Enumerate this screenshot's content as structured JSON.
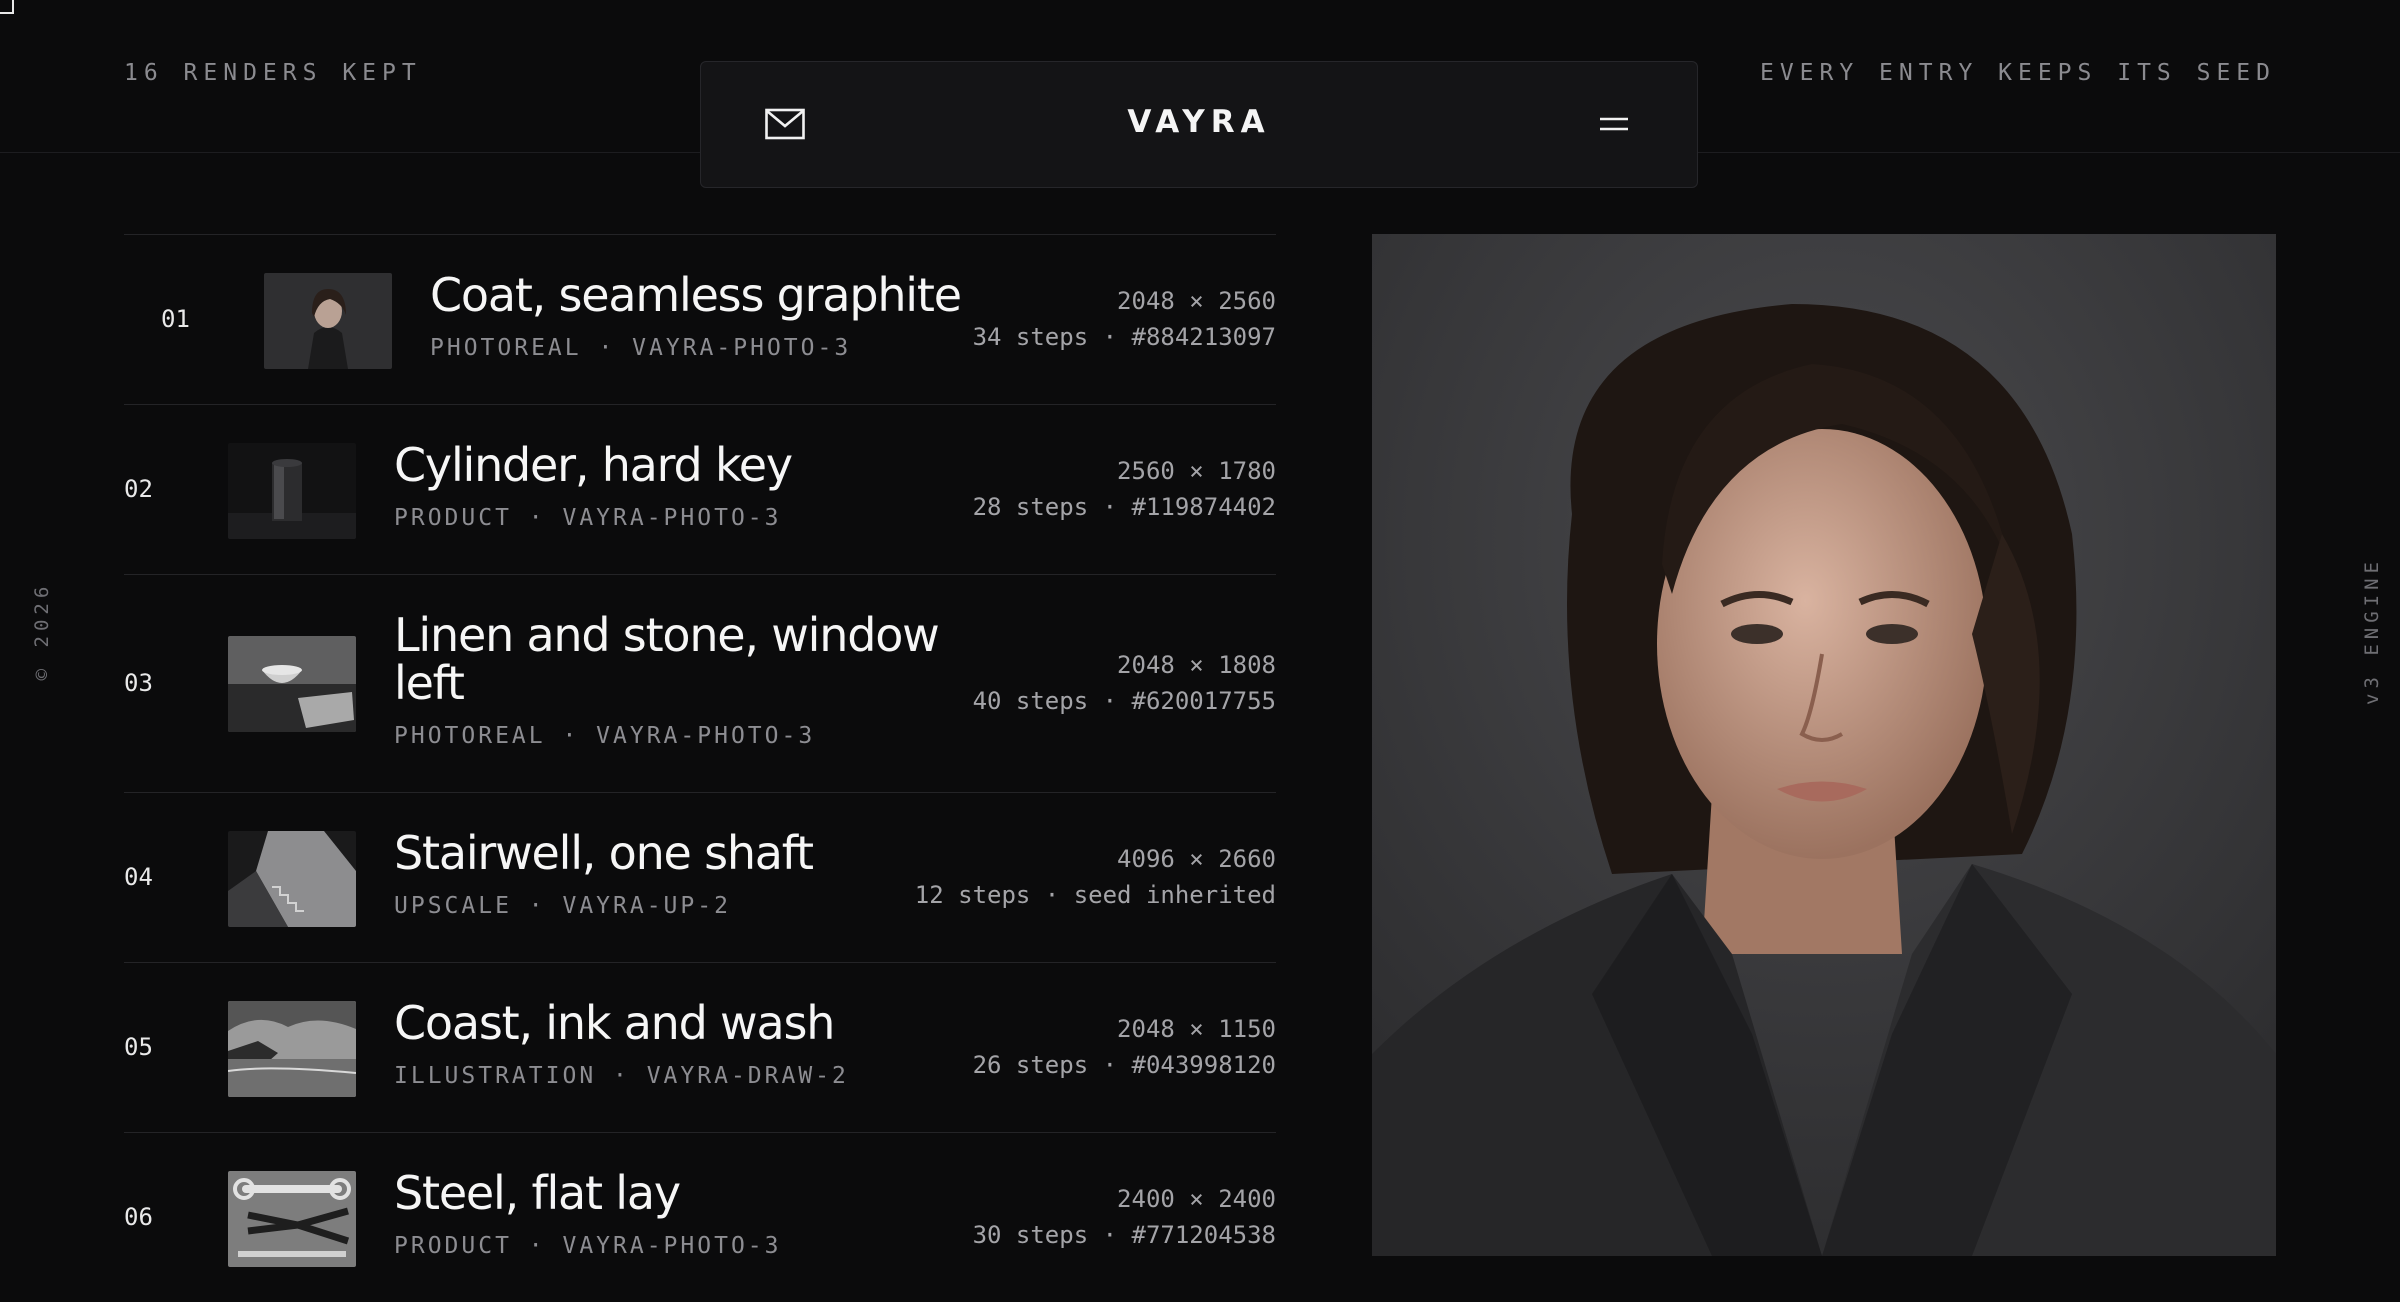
{
  "header": {
    "left_text": "16 RENDERS KEPT",
    "brand": "VAYRA",
    "right_text": "EVERY ENTRY KEEPS ITS SEED",
    "mail_icon": "mail-icon",
    "menu_icon": "menu-icon"
  },
  "side": {
    "left": "© 2026",
    "right": "v3 ENGINE"
  },
  "renders": [
    {
      "num": "01",
      "title": "Coat, seamless graphite",
      "meta": "PHOTOREAL · VAYRA-PHOTO-3",
      "dims": "2048 × 2560",
      "steps": "34 steps · #884213097",
      "thumb": "portrait"
    },
    {
      "num": "02",
      "title": "Cylinder, hard key",
      "meta": "PRODUCT · VAYRA-PHOTO-3",
      "dims": "2560 × 1780",
      "steps": "28 steps · #119874402",
      "thumb": "cylinder"
    },
    {
      "num": "03",
      "title": "Linen and stone, window left",
      "meta": "PHOTOREAL · VAYRA-PHOTO-3",
      "dims": "2048 × 1808",
      "steps": "40 steps · #620017755",
      "thumb": "bowl"
    },
    {
      "num": "04",
      "title": "Stairwell, one shaft",
      "meta": "UPSCALE · VAYRA-UP-2",
      "dims": "4096 × 2660",
      "steps": "12 steps · seed inherited",
      "thumb": "stairwell"
    },
    {
      "num": "05",
      "title": "Coast, ink and wash",
      "meta": "ILLUSTRATION · VAYRA-DRAW-2",
      "dims": "2048 × 1150",
      "steps": "26 steps · #043998120",
      "thumb": "coast"
    },
    {
      "num": "06",
      "title": "Steel, flat lay",
      "meta": "PRODUCT · VAYRA-PHOTO-3",
      "dims": "2400 × 2400",
      "steps": "30 steps · #771204538",
      "thumb": "tools"
    }
  ],
  "colors": {
    "background": "#0b0b0c",
    "text": "#f6f6f6",
    "muted": "#8d8d92",
    "divider": "#242427"
  }
}
